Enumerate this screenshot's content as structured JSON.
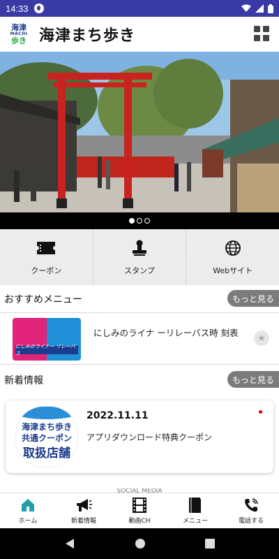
{
  "status_bar": {
    "time": "14:33"
  },
  "header": {
    "logo": {
      "line1": "海津",
      "line2": "MACHI",
      "line3": "歩き"
    },
    "title": "海津まち歩き",
    "menu_icon": "grid-icon"
  },
  "hero": {
    "pages": 3,
    "active_page": 1
  },
  "quick_actions": [
    {
      "label": "クーポン",
      "icon": "ticket-icon"
    },
    {
      "label": "スタンプ",
      "icon": "stamp-icon"
    },
    {
      "label": "Webサイト",
      "icon": "globe-icon"
    }
  ],
  "recommended": {
    "heading": "おすすめメニュー",
    "more_label": "もっと見る",
    "items": [
      {
        "title": "にしみのライナ ーリレーバス時 刻表",
        "thumb_banner": "にしみのライナー リレーバス",
        "favorite": false
      }
    ]
  },
  "news": {
    "heading": "新着情報",
    "more_label": "もっと見る",
    "items": [
      {
        "date": "2022.11.11",
        "text": "アプリダウンロード特典クーポン",
        "thumb_line1": "海津まち歩き",
        "thumb_line2": "共通クーポン",
        "thumb_line3": "取扱店舗",
        "unread": true
      }
    ]
  },
  "social_label": "SOCIAL MEDIA",
  "bottom_nav": [
    {
      "label": "ホーム",
      "icon": "home-icon",
      "active": true
    },
    {
      "label": "新着情報",
      "icon": "megaphone-icon",
      "active": false
    },
    {
      "label": "動画CH",
      "icon": "film-icon",
      "active": false
    },
    {
      "label": "メニュー",
      "icon": "book-icon",
      "active": false
    },
    {
      "label": "電話する",
      "icon": "phone-icon",
      "active": false
    }
  ],
  "colors": {
    "status_bar": "#3a3aa6",
    "accent": "#1fa0a8",
    "more_button": "#7b7b7b",
    "torii": "#c8231e"
  }
}
